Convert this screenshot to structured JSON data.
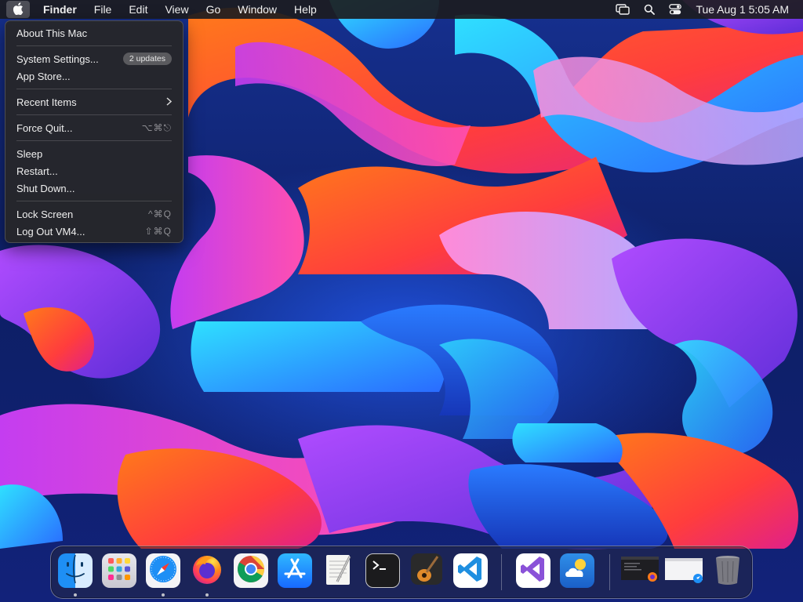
{
  "menubar": {
    "apple_icon": "apple-logo-icon",
    "app_name": "Finder",
    "menus": [
      "File",
      "Edit",
      "View",
      "Go",
      "Window",
      "Help"
    ],
    "status_icons": [
      "screen-mirroring-icon",
      "spotlight-search-icon",
      "control-center-icon"
    ],
    "clock": "Tue Aug 1  5:05 AM"
  },
  "apple_menu": {
    "about": "About This Mac",
    "system_settings": "System Settings...",
    "updates_badge": "2 updates",
    "app_store": "App Store...",
    "recent_items": "Recent Items",
    "force_quit": "Force Quit...",
    "force_quit_shortcut": "⌥⌘⎋",
    "sleep": "Sleep",
    "restart": "Restart...",
    "shut_down": "Shut Down...",
    "lock_screen": "Lock Screen",
    "lock_screen_shortcut": "^⌘Q",
    "log_out": "Log Out VM4...",
    "log_out_shortcut": "⇧⌘Q"
  },
  "dock": {
    "apps": [
      {
        "name": "Finder",
        "icon": "finder-icon",
        "running": true
      },
      {
        "name": "Launchpad",
        "icon": "launchpad-icon",
        "running": false
      },
      {
        "name": "Safari",
        "icon": "safari-icon",
        "running": true
      },
      {
        "name": "Firefox",
        "icon": "firefox-icon",
        "running": true
      },
      {
        "name": "Google Chrome",
        "icon": "chrome-icon",
        "running": false
      },
      {
        "name": "App Store",
        "icon": "app-store-icon",
        "running": false
      },
      {
        "name": "TextEdit",
        "icon": "textedit-icon",
        "running": false
      },
      {
        "name": "Terminal",
        "icon": "terminal-icon",
        "running": false
      },
      {
        "name": "GarageBand",
        "icon": "garageband-icon",
        "running": false
      },
      {
        "name": "Visual Studio Code",
        "icon": "vscode-icon",
        "running": false
      },
      {
        "name": "Visual Studio",
        "icon": "visual-studio-icon",
        "running": false
      },
      {
        "name": "Weather",
        "icon": "weather-icon",
        "running": false
      },
      {
        "name": "Firefox Window",
        "icon": "minimized-window-icon",
        "running": false
      },
      {
        "name": "Safari Window",
        "icon": "minimized-window-icon",
        "running": false
      },
      {
        "name": "Trash",
        "icon": "trash-icon",
        "running": false
      }
    ]
  },
  "colors": {
    "menubar_bg": "#1c1c20",
    "menu_bg": "#26262a",
    "wallpaper_blue": "#1f4fd8",
    "wallpaper_orange": "#ff5a1f",
    "wallpaper_magenta": "#d63af0",
    "wallpaper_cyan": "#28c8f0"
  }
}
